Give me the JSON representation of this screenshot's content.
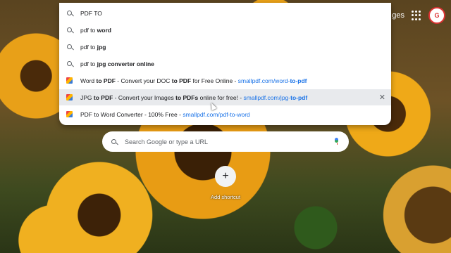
{
  "topbar": {
    "images_label": "ges"
  },
  "suggestions": [
    {
      "kind": "search",
      "plain": "PDF TO",
      "bold": "",
      "url_plain": "",
      "url_bold": ""
    },
    {
      "kind": "search",
      "plain": "pdf to ",
      "bold": "word",
      "url_plain": "",
      "url_bold": ""
    },
    {
      "kind": "search",
      "plain": "pdf to ",
      "bold": "jpg",
      "url_plain": "",
      "url_bold": ""
    },
    {
      "kind": "search",
      "plain": "pdf to ",
      "bold": "jpg converter online",
      "url_plain": "",
      "url_bold": ""
    },
    {
      "kind": "site",
      "pre": "Word ",
      "bold": "to PDF",
      "post": " - Convert your DOC ",
      "bold2": "to PDF",
      "post2": " for Free Online - ",
      "url_plain": "smallpdf.com/word-",
      "url_bold": "to-pdf"
    },
    {
      "kind": "site",
      "pre": "JPG ",
      "bold": "to PDF",
      "post": " - Convert your Images ",
      "bold2": "to PDFs",
      "post2": " online for free! - ",
      "url_plain": "smallpdf.com/jpg-",
      "url_bold": "to-pdf"
    },
    {
      "kind": "site",
      "pre": "PDF to Word Converter - 100% Free - ",
      "bold": "",
      "post": "",
      "bold2": "",
      "post2": "",
      "url_plain": "smallpdf.com/pdf-to-word",
      "url_bold": ""
    }
  ],
  "close_glyph": "✕",
  "search": {
    "placeholder": "Search Google or type a URL"
  },
  "shortcut": {
    "label": "Add shortcut",
    "glyph": "+"
  },
  "avatar": {
    "text": "G"
  }
}
